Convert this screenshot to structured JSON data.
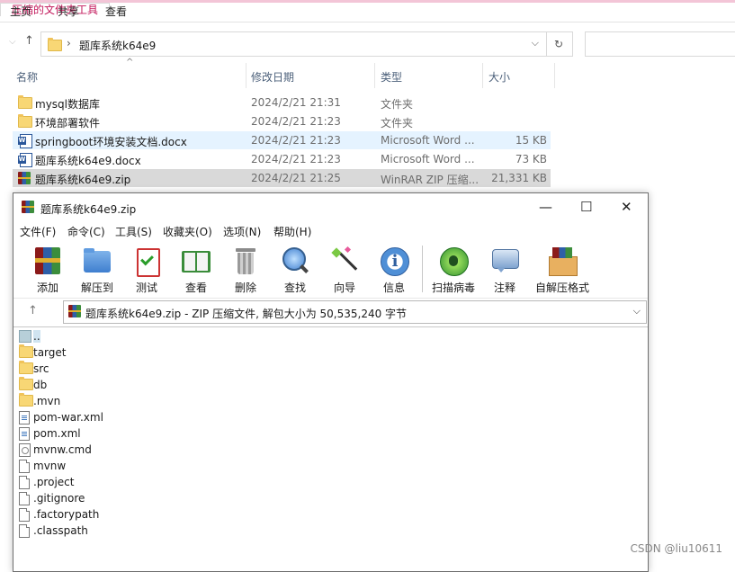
{
  "explorer": {
    "ribbon_tabs": [
      "主页",
      "共享",
      "查看"
    ],
    "context_tab": "压缩的文件夹工具",
    "address": {
      "path": "题库系统k64e9",
      "separator": "›",
      "back": "←",
      "forward": "→",
      "up": "↑",
      "dropdown": "⌵",
      "refresh": "↻"
    },
    "columns": {
      "name": "名称",
      "date": "修改日期",
      "type": "类型",
      "size": "大小"
    },
    "files": [
      {
        "icon": "folder-icon",
        "name": "mysql数据库",
        "date": "2024/2/21 21:31",
        "type": "文件夹",
        "size": ""
      },
      {
        "icon": "folder-icon",
        "name": "环境部署软件",
        "date": "2024/2/21 21:23",
        "type": "文件夹",
        "size": ""
      },
      {
        "icon": "word-document-icon",
        "name": "springboot环境安装文档.docx",
        "date": "2024/2/21 21:23",
        "type": "Microsoft Word ...",
        "size": "15 KB"
      },
      {
        "icon": "word-document-icon",
        "name": "题库系统k64e9.docx",
        "date": "2024/2/21 21:23",
        "type": "Microsoft Word ...",
        "size": "73 KB"
      },
      {
        "icon": "winrar-archive-icon",
        "name": "题库系统k64e9.zip",
        "date": "2024/2/21 21:25",
        "type": "WinRAR ZIP 压缩...",
        "size": "21,331 KB"
      }
    ]
  },
  "winrar": {
    "title": "题库系统k64e9.zip",
    "window_buttons": {
      "minimize": "—",
      "maximize": "☐",
      "close": "✕"
    },
    "menu": [
      "文件(F)",
      "命令(C)",
      "工具(S)",
      "收藏夹(O)",
      "选项(N)",
      "帮助(H)"
    ],
    "toolbar": [
      "添加",
      "解压到",
      "测试",
      "查看",
      "删除",
      "查找",
      "向导",
      "信息",
      "扫描病毒",
      "注释",
      "自解压格式"
    ],
    "path_up": "↑",
    "path_text": "题库系统k64e9.zip - ZIP 压缩文件, 解包大小为 50,535,240 字节",
    "path_dropdown": "⌵",
    "entries": [
      {
        "icon": "parent-folder-icon",
        "name": ".."
      },
      {
        "icon": "folder-icon",
        "name": "target"
      },
      {
        "icon": "folder-icon",
        "name": "src"
      },
      {
        "icon": "folder-icon",
        "name": "db"
      },
      {
        "icon": "folder-icon",
        "name": ".mvn"
      },
      {
        "icon": "xml-file-icon",
        "name": "pom-war.xml"
      },
      {
        "icon": "xml-file-icon",
        "name": "pom.xml"
      },
      {
        "icon": "cmd-file-icon",
        "name": "mvnw.cmd"
      },
      {
        "icon": "file-icon",
        "name": "mvnw"
      },
      {
        "icon": "file-icon",
        "name": ".project"
      },
      {
        "icon": "file-icon",
        "name": ".gitignore"
      },
      {
        "icon": "file-icon",
        "name": ".factorypath"
      },
      {
        "icon": "file-icon",
        "name": ".classpath"
      }
    ]
  },
  "watermark": "CSDN @liu10611"
}
